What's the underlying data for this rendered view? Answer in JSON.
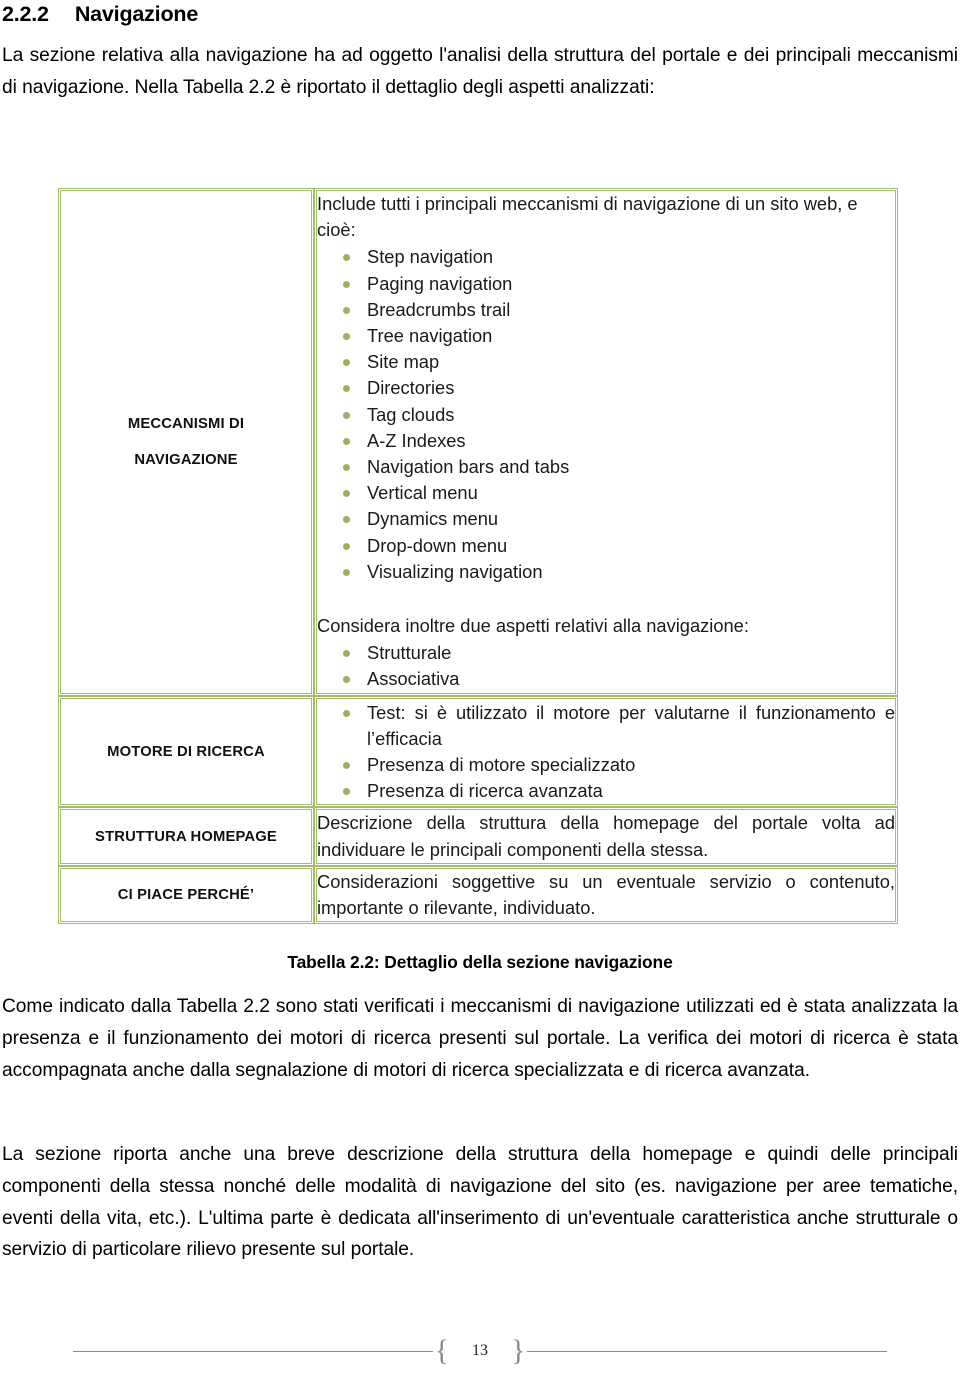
{
  "heading": {
    "number": "2.2.2",
    "title": "Navigazione"
  },
  "paragraphs": {
    "intro": "La sezione relativa alla navigazione ha ad oggetto l'analisi della struttura del portale e dei principali meccanismi di navigazione. Nella Tabella 2.2 è riportato il dettaglio degli aspetti analizzati:",
    "after_table": "Come indicato dalla Tabella 2.2 sono stati verificati i meccanismi di navigazione utilizzati ed è stata analizzata la presenza e il funzionamento dei motori di ricerca presenti sul portale. La verifica dei motori di ricerca è stata accompagnata anche dalla segnalazione di motori di ricerca specializzata e di ricerca avanzata.",
    "final": "La sezione riporta anche una breve descrizione della struttura della homepage e quindi delle principali componenti della stessa nonché delle modalità di navigazione del sito (es. navigazione per aree tematiche, eventi della vita, etc.). L'ultima parte è dedicata all'inserimento di un'eventuale caratteristica anche strutturale o servizio di particolare rilievo presente sul portale."
  },
  "table": {
    "caption": "Tabella 2.2: Dettaglio della sezione navigazione",
    "border_color": "#A5BD6B",
    "bullet_color": "#9AB15F",
    "rows": [
      {
        "label_line1": "MECCANISMI DI",
        "label_line2": "NAVIGAZIONE",
        "lead": "Include tutti i principali meccanismi di navigazione di un sito web, e cioè:",
        "bullets": [
          "Step navigation",
          "Paging navigation",
          "Breadcrumbs trail",
          "Tree navigation",
          "Site map",
          "Directories",
          "Tag clouds",
          "A-Z Indexes",
          "Navigation bars and tabs",
          "Vertical menu",
          "Dynamics menu",
          "Drop-down menu",
          "Visualizing navigation"
        ],
        "lead2": "Considera inoltre due aspetti relativi alla navigazione:",
        "bullets2": [
          "Strutturale",
          "Associativa"
        ]
      },
      {
        "label_line1": "MOTORE DI RICERCA",
        "bullets": [
          "Test: si è utilizzato il motore per valutarne il funzionamento e l’efficacia",
          "Presenza di motore specializzato",
          "Presenza di ricerca avanzata"
        ]
      },
      {
        "label_line1": "STRUTTURA HOMEPAGE",
        "text": "Descrizione della struttura della homepage del portale volta ad individuare le principali componenti della stessa."
      },
      {
        "label_line1": "CI PIACE PERCHÉ’",
        "text": "Considerazioni soggettive su un eventuale servizio o contenuto, importante o rilevante, individuato."
      }
    ]
  },
  "footer": {
    "open_brace": "{",
    "page_number": "13",
    "close_brace": "}"
  }
}
